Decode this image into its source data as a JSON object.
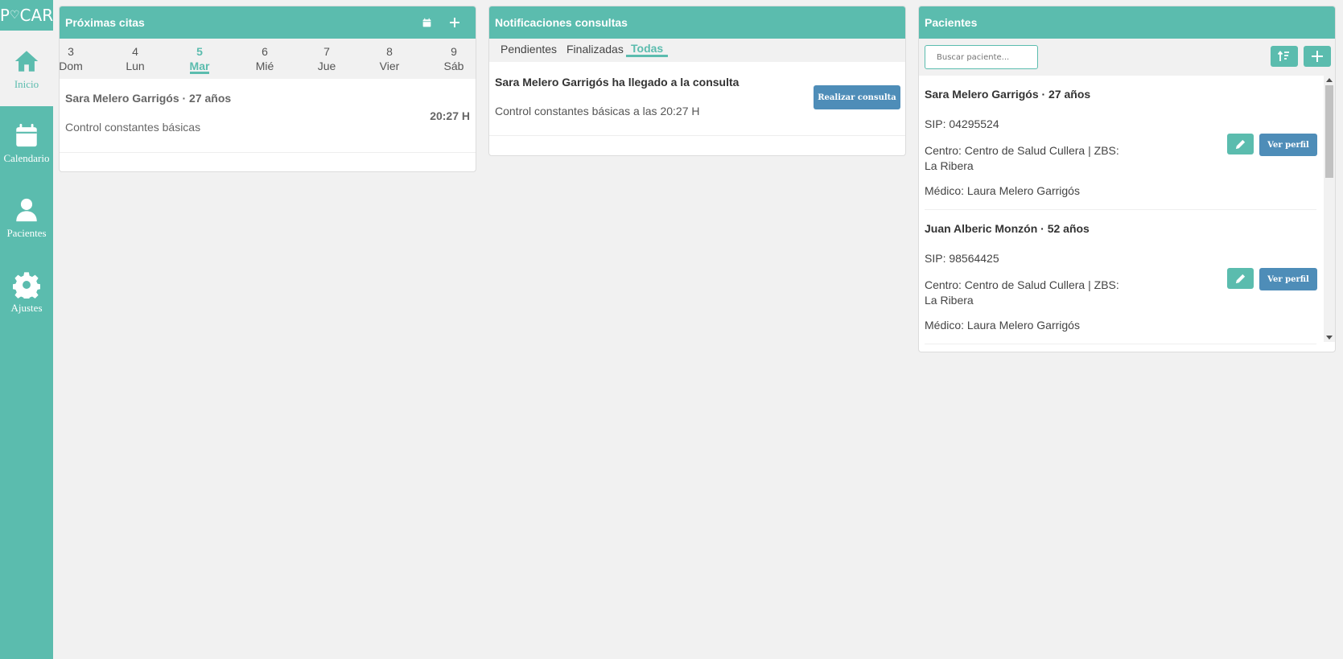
{
  "app": {
    "logo_left": "P",
    "logo_heart": "♡",
    "logo_right": "CAR"
  },
  "sidebar": {
    "items": [
      {
        "label": "Inicio",
        "icon": "home-icon",
        "active": true
      },
      {
        "label": "Calendario",
        "icon": "calendar-icon",
        "active": false
      },
      {
        "label": "Pacientes",
        "icon": "user-icon",
        "active": false
      },
      {
        "label": "Ajustes",
        "icon": "gear-icon",
        "active": false
      }
    ]
  },
  "citas": {
    "title": "Próximas citas",
    "days": [
      {
        "num": "3",
        "name": "Dom"
      },
      {
        "num": "4",
        "name": "Lun"
      },
      {
        "num": "5",
        "name": "Mar"
      },
      {
        "num": "6",
        "name": "Mié"
      },
      {
        "num": "7",
        "name": "Jue"
      },
      {
        "num": "8",
        "name": "Vier"
      },
      {
        "num": "9",
        "name": "Sáb"
      }
    ],
    "active_day": "5",
    "appointments": [
      {
        "name": "Sara Melero Garrigós · 27 años",
        "time": "20:27 H",
        "desc": "Control constantes básicas"
      }
    ]
  },
  "notificaciones": {
    "title": "Notificaciones consultas",
    "tabs": [
      "Pendientes",
      "Finalizadas",
      "Todas"
    ],
    "active_tab": "Todas",
    "items": [
      {
        "title": "Sara Melero Garrigós ha llegado a la consulta",
        "desc": "Control constantes básicas a las 20:27 H",
        "button": "Realizar consulta"
      }
    ]
  },
  "pacientes": {
    "title": "Pacientes",
    "search_placeholder": "Buscar paciente...",
    "items": [
      {
        "name": "Sara Melero Garrigós · 27 años",
        "sip": "SIP: 04295524",
        "centro": "Centro: Centro de Salud Cullera | ZBS: La Ribera",
        "medico": "Médico: Laura Melero Garrigós",
        "button": "Ver perfil"
      },
      {
        "name": "Juan Alberic Monzón · 52 años",
        "sip": "SIP: 98564425",
        "centro": "Centro: Centro de Salud Cullera | ZBS: La Ribera",
        "medico": "Médico: Laura Melero Garrigós",
        "button": "Ver perfil"
      }
    ]
  },
  "colors": {
    "accent": "#5bbcae",
    "button_blue": "#4e8db8",
    "background": "#f1f1f1"
  }
}
